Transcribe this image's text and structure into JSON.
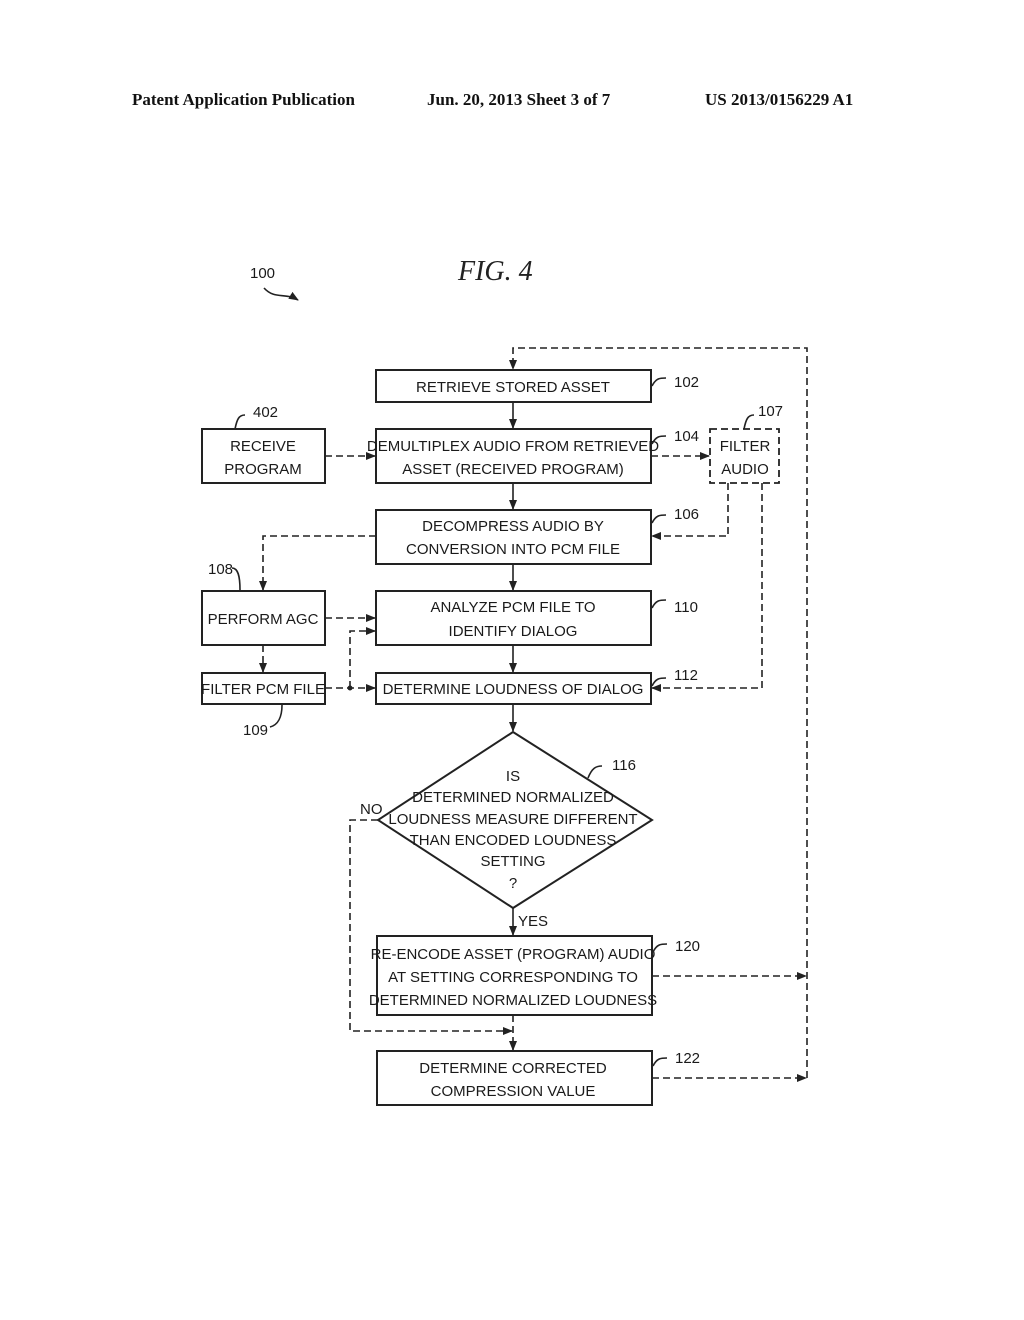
{
  "header": {
    "left": "Patent Application Publication",
    "center": "Jun. 20, 2013  Sheet 3 of 7",
    "right": "US 2013/0156229 A1"
  },
  "figure": {
    "title": "FIG.  4",
    "ref": "100"
  },
  "nodes": {
    "n102": {
      "ref": "102",
      "lines": [
        "RETRIEVE STORED ASSET"
      ]
    },
    "n104": {
      "ref": "104",
      "lines": [
        "DEMULTIPLEX AUDIO FROM RETRIEVED",
        "ASSET (RECEIVED PROGRAM)"
      ]
    },
    "n402": {
      "ref": "402",
      "lines": [
        "RECEIVE",
        "PROGRAM"
      ]
    },
    "n107": {
      "ref": "107",
      "lines": [
        "FILTER",
        "AUDIO"
      ]
    },
    "n106": {
      "ref": "106",
      "lines": [
        "DECOMPRESS AUDIO BY",
        "CONVERSION INTO PCM FILE"
      ]
    },
    "n108": {
      "ref": "108",
      "lines": [
        "PERFORM AGC"
      ]
    },
    "n110": {
      "ref": "110",
      "lines": [
        "ANALYZE PCM FILE TO",
        "IDENTIFY DIALOG"
      ]
    },
    "n109": {
      "ref": "109",
      "lines": [
        "FILTER PCM FILE"
      ]
    },
    "n112": {
      "ref": "112",
      "lines": [
        "DETERMINE LOUDNESS OF DIALOG"
      ]
    },
    "n116": {
      "ref": "116",
      "lines": [
        "IS",
        "DETERMINED NORMALIZED",
        "LOUDNESS MEASURE DIFFERENT",
        "THAN ENCODED LOUDNESS",
        "SETTING",
        "?"
      ]
    },
    "n120": {
      "ref": "120",
      "lines": [
        "RE-ENCODE ASSET (PROGRAM) AUDIO",
        "AT SETTING CORRESPONDING TO",
        "DETERMINED NORMALIZED LOUDNESS"
      ]
    },
    "n122": {
      "ref": "122",
      "lines": [
        "DETERMINE CORRECTED",
        "COMPRESSION VALUE"
      ]
    }
  },
  "edge_labels": {
    "no": "NO",
    "yes": "YES"
  }
}
